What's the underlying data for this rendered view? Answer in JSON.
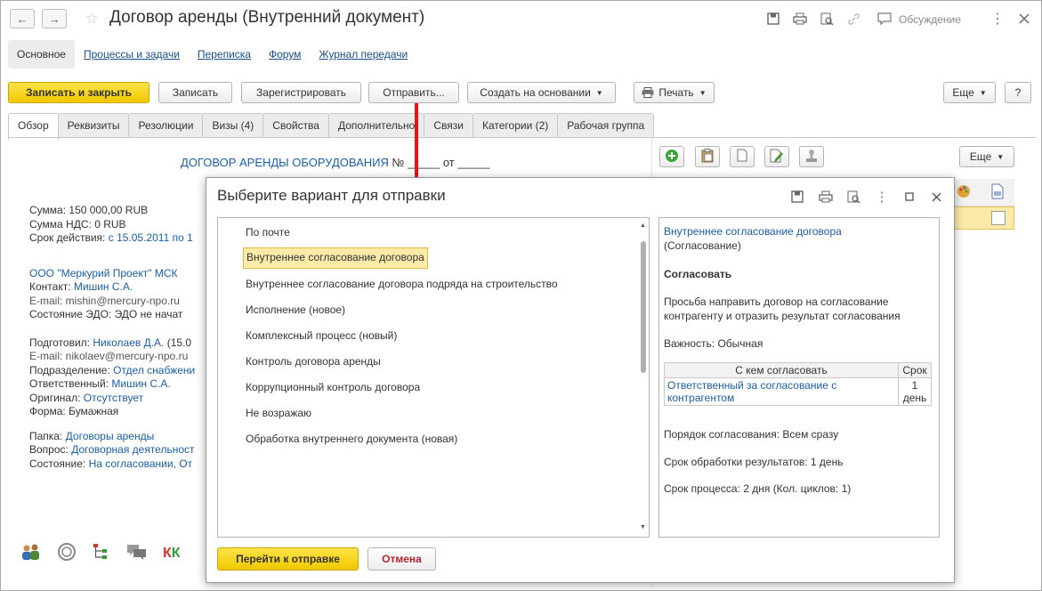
{
  "window": {
    "title": "Договор аренды (Внутренний документ)",
    "discussion_label": "Обсуждение"
  },
  "sections": [
    {
      "label": "Основное"
    },
    {
      "label": "Процессы и задачи"
    },
    {
      "label": "Переписка"
    },
    {
      "label": "Форум"
    },
    {
      "label": "Журнал передачи"
    }
  ],
  "toolbar": {
    "save_close": "Записать и закрыть",
    "save": "Записать",
    "register": "Зарегистрировать",
    "send": "Отправить...",
    "create_based": "Создать на основании",
    "print": "Печать",
    "more": "Еще",
    "help": "?"
  },
  "tabs": [
    {
      "label": "Обзор"
    },
    {
      "label": "Реквизиты"
    },
    {
      "label": "Резолюции"
    },
    {
      "label": "Визы (4)"
    },
    {
      "label": "Свойства"
    },
    {
      "label": "Дополнительно"
    },
    {
      "label": "Связи"
    },
    {
      "label": "Категории (2)"
    },
    {
      "label": "Рабочая группа"
    }
  ],
  "overview": {
    "doc_heading": "ДОГОВОР АРЕНДЫ ОБОРУДОВАНИЯ",
    "doc_heading_suffix": "№ _____ от _____",
    "sum_label": "Сумма:",
    "sum_value": "150 000,00 RUB",
    "vat_label": "Сумма НДС:",
    "vat_value": "0 RUB",
    "term_label": "Срок действия:",
    "term_value": "с 15.05.2011 по 1",
    "org": "ООО \"Меркурий Проект\" МСК",
    "contact_label": "Контакт:",
    "contact_value": "Мишин С.А.",
    "email1": "E-mail: mishin@mercury-npo.ru",
    "edo_label": "Состояние ЭДО:",
    "edo_value": "ЭДО не начат",
    "prepared_label": "Подготовил:",
    "prepared_value": "Николаев Д.А.",
    "prepared_suffix": "(15.0",
    "email2": "E-mail: nikolaev@mercury-npo.ru",
    "dept_label": "Подразделение:",
    "dept_value": "Отдел снабжени",
    "resp_label": "Ответственный:",
    "resp_value": "Мишин С.А.",
    "original_label": "Оригинал:",
    "original_value": "Отсутствует",
    "form_label": "Форма:",
    "form_value": "Бумажная",
    "folder_label": "Папка:",
    "folder_value": "Договоры аренды",
    "question_label": "Вопрос:",
    "question_value": "Договорная деятельност",
    "state_label": "Состояние:",
    "state_value": "На согласовании, От"
  },
  "right_panel": {
    "more": "Еще"
  },
  "dialog": {
    "title": "Выберите вариант для отправки",
    "options": [
      {
        "label": "По почте"
      },
      {
        "label": "Внутреннее согласование договора",
        "selected": true
      },
      {
        "label": "Внутреннее согласование договора подряда на строительство"
      },
      {
        "label": "Исполнение (новое)"
      },
      {
        "label": "Комплексный процесс (новый)"
      },
      {
        "label": "Контроль договора аренды"
      },
      {
        "label": "Коррупционный контроль договора"
      },
      {
        "label": "Не возражаю"
      },
      {
        "label": "Обработка внутреннего документа (новая)"
      }
    ],
    "info": {
      "link": "Внутреннее согласование договора",
      "type": "(Согласование)",
      "action": "Согласовать",
      "description": "Просьба направить договор на согласование контрагенту и отразить результат согласования",
      "importance_label": "Важность:",
      "importance_value": "Обычная",
      "table_headers": [
        "С кем согласовать",
        "Срок"
      ],
      "table_rows": [
        {
          "who": "Ответственный за согласование с контрагентом",
          "term": "1 день"
        }
      ],
      "order_label": "Порядок согласования:",
      "order_value": "Всем сразу",
      "processing_label": "Срок обработки результатов:",
      "processing_value": "1 день",
      "process_label": "Срок процесса:",
      "process_value": "2 дня (Кол. циклов: 1)"
    },
    "go_button": "Перейти к отправке",
    "cancel_button": "Отмена"
  },
  "colors": {
    "accent_yellow": "#f5d20f",
    "link_blue": "#1a5fa8",
    "arrow_red": "#e8141b",
    "selection": "#fbeaa8"
  }
}
